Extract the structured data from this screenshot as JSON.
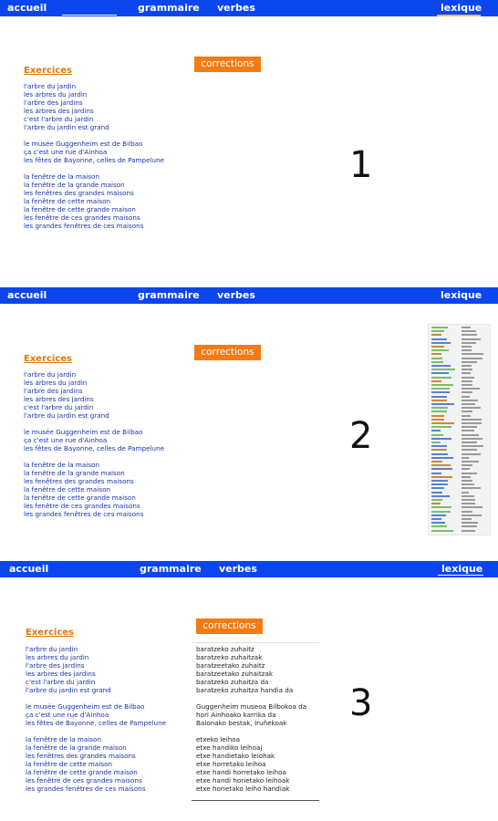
{
  "nav": {
    "accueil": "accueil",
    "grammaire": "grammaire",
    "verbes": "verbes",
    "lexique": "lexique"
  },
  "colors": {
    "navbar": "#0a45ee",
    "accent_orange": "#f47a15",
    "title_orange": "#e0780c",
    "list_blue": "#1b33a6",
    "lexique_underline_1": "#e8c23a",
    "lexique_underline_2": "#ffffff"
  },
  "exercises_title": "Exercices",
  "corrections_label": "corrections",
  "exercise_groups": [
    [
      "l'arbre du jardin",
      "les arbres du jardin",
      "l'arbre des jardins",
      "les arbres des jardins",
      "c'est l'arbre du jardin",
      "l'arbre du jardin est grand"
    ],
    [
      "le musée Guggenheim est de Bilbao",
      "ça c'est une rue d'Ainhoa",
      "les fêtes de Bayonne, celles de Pampelune"
    ],
    [
      "la fenêtre de la maison",
      "la fenêtre de la grande maison",
      "les fenêtres des grandes maisons",
      "la fenêtre de cette maison",
      "la fenêtre de cette grande maison",
      "les fenêtre de ces grandes maisons",
      "les grandes fenêtres de ces maisons"
    ]
  ],
  "correction_groups": [
    [
      "baratzeko zuhaitz",
      "baratzeko zuhaitzak",
      "baratzeetako zuhaitz",
      "baratzeetako zuhaitzak",
      "baratzeko zuhaitza da",
      "baratzeko zuhaitza handia da"
    ],
    [
      "Guggenheim museoa Bilbokoa da",
      "hori Ainhoako karrika da",
      "Baionako bestak, Iruñekoak"
    ],
    [
      "etxeko leihoa",
      "etxe handiko leihoaj",
      "etxe handietako leiohak",
      "etxe horretako leihoa",
      "etxe handi horretako leihoa",
      "etxe handi horietako leihoak",
      "etxe horietako leiho handiak"
    ]
  ],
  "panels": [
    {
      "number": "1"
    },
    {
      "number": "2"
    },
    {
      "number": "3"
    }
  ]
}
